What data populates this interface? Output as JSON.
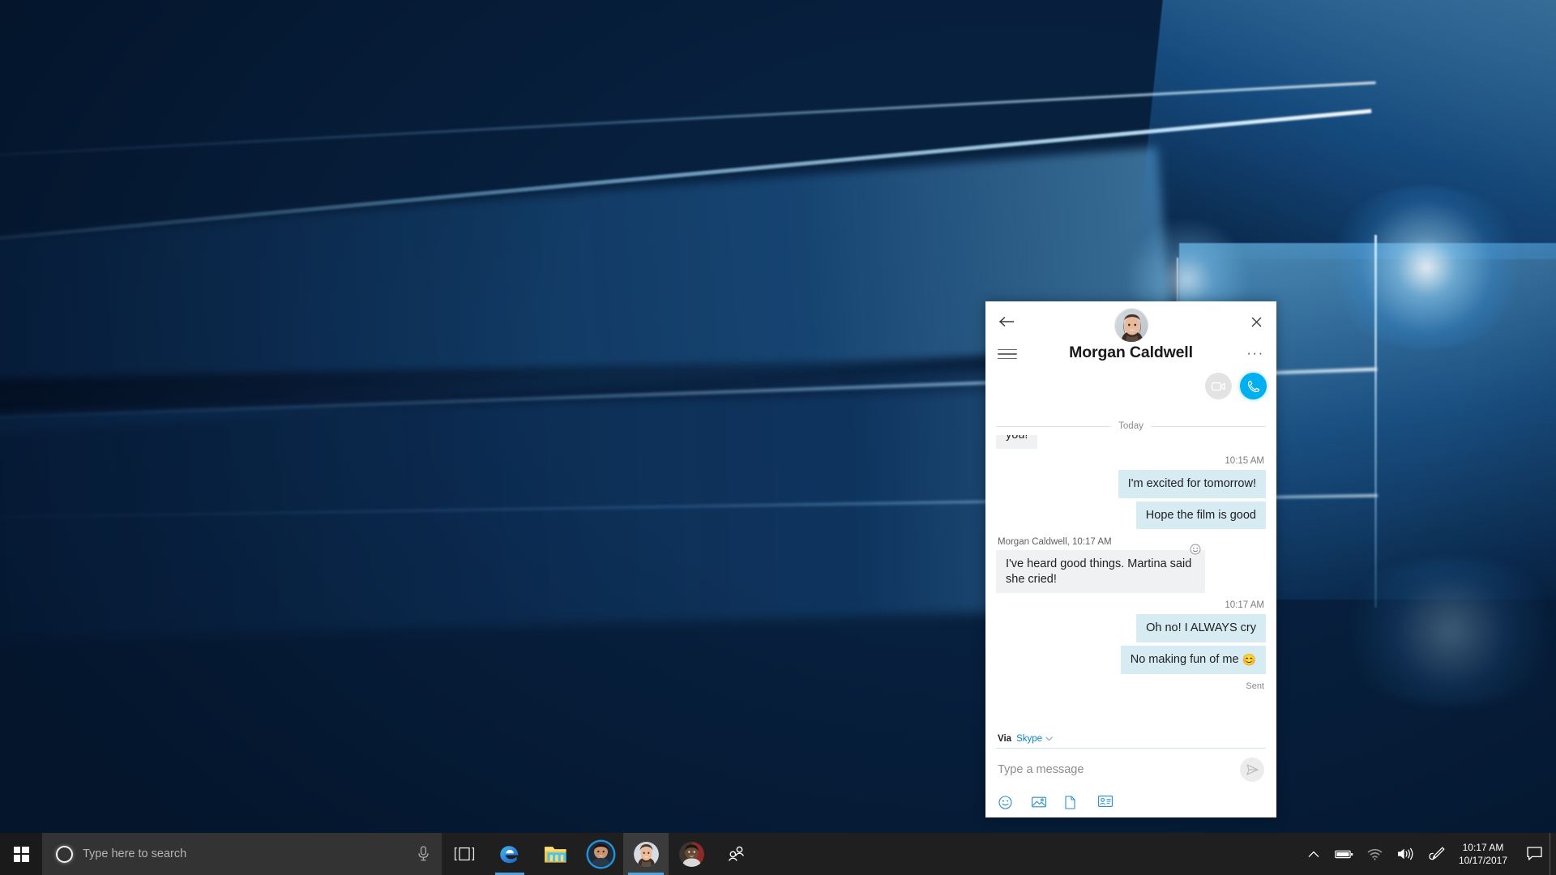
{
  "desktop": {
    "wallpaper_name": "windows-10-hero-wallpaper",
    "colors": {
      "wallpaper_dark": "#072044",
      "wallpaper_light": "#2e9ae8",
      "taskbar": "#1f1f1f",
      "search_box": "#333333",
      "skype_blue": "#00aff0",
      "accent_underline": "#4fa3e3",
      "bubble_incoming": "#f0f1f3",
      "bubble_outgoing": "#d7ebf3"
    }
  },
  "people_window": {
    "header": {
      "back_label": "←",
      "close_label": "✕",
      "contact_name": "Morgan Caldwell",
      "more_label": "···",
      "avatar_alt": "Morgan Caldwell avatar",
      "video_call_label": "Video call",
      "audio_call_label": "Audio call"
    },
    "conversation": {
      "day_divider": "Today",
      "messages": [
        {
          "id": "m0",
          "direction": "in",
          "text": "you!",
          "clipped": true
        },
        {
          "id": "t1",
          "type": "timestamp",
          "text": "10:15 AM"
        },
        {
          "id": "m1",
          "direction": "out",
          "text": "I'm excited for tomorrow!"
        },
        {
          "id": "m2",
          "direction": "out",
          "text": "Hope the film is good"
        },
        {
          "id": "s1",
          "type": "sender",
          "text": "Morgan Caldwell, 10:17 AM"
        },
        {
          "id": "m3",
          "direction": "in",
          "text": "I've heard good things. Martina said she cried!",
          "reaction": "smiley-outline"
        },
        {
          "id": "t2",
          "type": "timestamp",
          "text": "10:17 AM"
        },
        {
          "id": "m4",
          "direction": "out",
          "text": "Oh no! I ALWAYS cry"
        },
        {
          "id": "m5",
          "direction": "out",
          "text": "No making fun of me ",
          "emoji": "😊"
        },
        {
          "id": "st1",
          "type": "status",
          "text": "Sent"
        }
      ]
    },
    "compose": {
      "via_label": "Via",
      "via_value": "Skype",
      "via_chevron": "⌄",
      "input_placeholder": "Type a message",
      "input_value": "",
      "send_label": "Send",
      "attachments": [
        {
          "name": "emoji-icon",
          "label": "Emoji"
        },
        {
          "name": "image-icon",
          "label": "Picture"
        },
        {
          "name": "file-icon",
          "label": "File"
        },
        {
          "name": "contact-card-icon",
          "label": "Contact card"
        }
      ]
    }
  },
  "taskbar": {
    "start_label": "Start",
    "search": {
      "placeholder": "Type here to search",
      "value": "",
      "cortana_label": "Cortana",
      "mic_label": "Talk to Cortana"
    },
    "buttons": [
      {
        "name": "task-view-button",
        "label": "Task View",
        "active": false
      },
      {
        "name": "edge-button",
        "label": "Microsoft Edge",
        "active": true
      },
      {
        "name": "file-explorer-button",
        "label": "File Explorer",
        "active": false
      }
    ],
    "people": [
      {
        "name": "people-contact-1",
        "label": "Contact 1",
        "active": false,
        "ringed": true
      },
      {
        "name": "people-contact-morgan",
        "label": "Morgan Caldwell",
        "active": true,
        "ringed": false
      },
      {
        "name": "people-contact-3",
        "label": "Contact 3",
        "active": false,
        "ringed": false
      }
    ],
    "my_people_label": "My People",
    "tray": {
      "overflow_label": "Show hidden icons",
      "battery_label": "Battery",
      "network_label": "Network",
      "volume_label": "Volume",
      "pen_label": "Windows Ink Workspace",
      "time": "10:17 AM",
      "date": "10/17/2017",
      "action_center_label": "Action Center",
      "show_desktop_label": "Show desktop"
    }
  }
}
